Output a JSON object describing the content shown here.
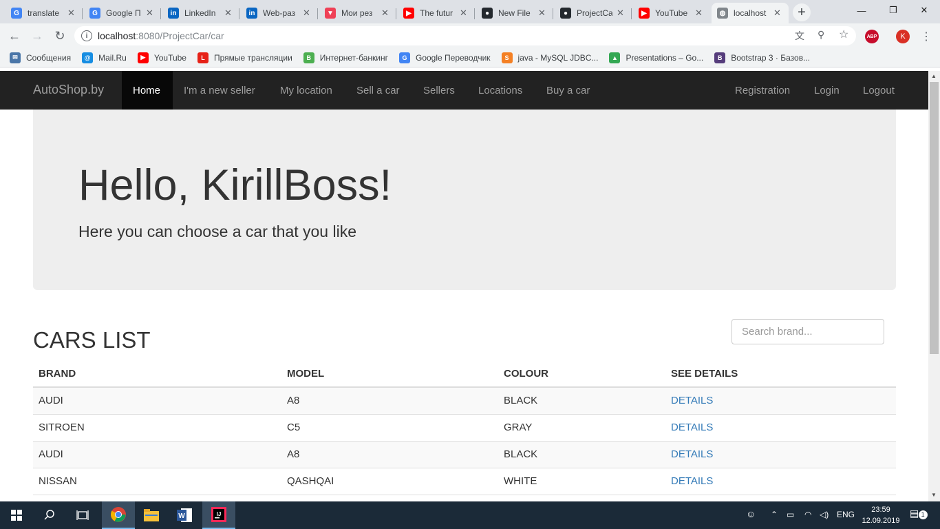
{
  "browser": {
    "tabs": [
      {
        "title": "translate",
        "icon": "google-translate-icon",
        "color": "#4285f4",
        "glyph": "G"
      },
      {
        "title": "Google П",
        "icon": "google-translate-icon",
        "color": "#4285f4",
        "glyph": "G"
      },
      {
        "title": "LinkedIn",
        "icon": "linkedin-icon",
        "color": "#0a66c2",
        "glyph": "in"
      },
      {
        "title": "Web-раз",
        "icon": "linkedin-icon",
        "color": "#0a66c2",
        "glyph": "in"
      },
      {
        "title": "Мои рез",
        "icon": "pocket-icon",
        "color": "#ef4056",
        "glyph": "▼"
      },
      {
        "title": "The futur",
        "icon": "youtube-icon",
        "color": "#ff0000",
        "glyph": "▶"
      },
      {
        "title": "New File",
        "icon": "github-icon",
        "color": "#24292e",
        "glyph": "●"
      },
      {
        "title": "ProjectCa",
        "icon": "github-icon",
        "color": "#24292e",
        "glyph": "●"
      },
      {
        "title": "YouTube",
        "icon": "youtube-icon",
        "color": "#ff0000",
        "glyph": "▶"
      },
      {
        "title": "localhost",
        "icon": "globe-icon",
        "color": "#80868b",
        "glyph": "◍"
      }
    ],
    "address": {
      "host": "localhost",
      "path": ":8080/ProjectCar/car"
    },
    "profile_initial": "K",
    "abp_label": "ABP",
    "bookmarks": [
      {
        "label": "Сообщения",
        "icon": "chat-icon",
        "color": "#4a76a8",
        "glyph": "✉"
      },
      {
        "label": "Mail.Ru",
        "icon": "mailru-icon",
        "color": "#168de2",
        "glyph": "@"
      },
      {
        "label": "YouTube",
        "icon": "youtube-icon",
        "color": "#ff0000",
        "glyph": "▶"
      },
      {
        "label": "Прямые трансляции",
        "icon": "live-icon",
        "color": "#e62117",
        "glyph": "L"
      },
      {
        "label": "Интернет-банкинг",
        "icon": "bank-icon",
        "color": "#4caf50",
        "glyph": "B"
      },
      {
        "label": "Google Переводчик",
        "icon": "google-translate-icon",
        "color": "#4285f4",
        "glyph": "G"
      },
      {
        "label": "java - MySQL JDBC...",
        "icon": "stackoverflow-icon",
        "color": "#f48024",
        "glyph": "S"
      },
      {
        "label": "Presentations – Go...",
        "icon": "google-drive-icon",
        "color": "#34a853",
        "glyph": "▲"
      },
      {
        "label": "Bootstrap 3 · Базов...",
        "icon": "bootstrap-icon",
        "color": "#563d7c",
        "glyph": "B"
      }
    ]
  },
  "site": {
    "brand": "AutoShop.by",
    "nav_left": [
      "Home",
      "I'm a new seller",
      "My location",
      "Sell a car",
      "Sellers",
      "Locations",
      "Buy a car"
    ],
    "nav_right": [
      "Registration",
      "Login",
      "Logout"
    ],
    "hero": {
      "title": "Hello, KirillBoss!",
      "subtitle": "Here you can choose a car that you like"
    },
    "cars": {
      "title": "CARS LIST",
      "search_placeholder": "Search brand...",
      "columns": [
        "BRAND",
        "MODEL",
        "COLOUR",
        "SEE DETAILS"
      ],
      "rows": [
        {
          "brand": "AUDI",
          "model": "A8",
          "colour": "BLACK",
          "link": "DETAILS"
        },
        {
          "brand": "SITROEN",
          "model": "C5",
          "colour": "GRAY",
          "link": "DETAILS"
        },
        {
          "brand": "AUDI",
          "model": "A8",
          "colour": "BLACK",
          "link": "DETAILS"
        },
        {
          "brand": "NISSAN",
          "model": "QASHQAI",
          "colour": "WHITE",
          "link": "DETAILS"
        }
      ]
    }
  },
  "taskbar": {
    "language": "ENG",
    "time": "23:59",
    "date": "12.09.2019",
    "notifications": "1"
  }
}
